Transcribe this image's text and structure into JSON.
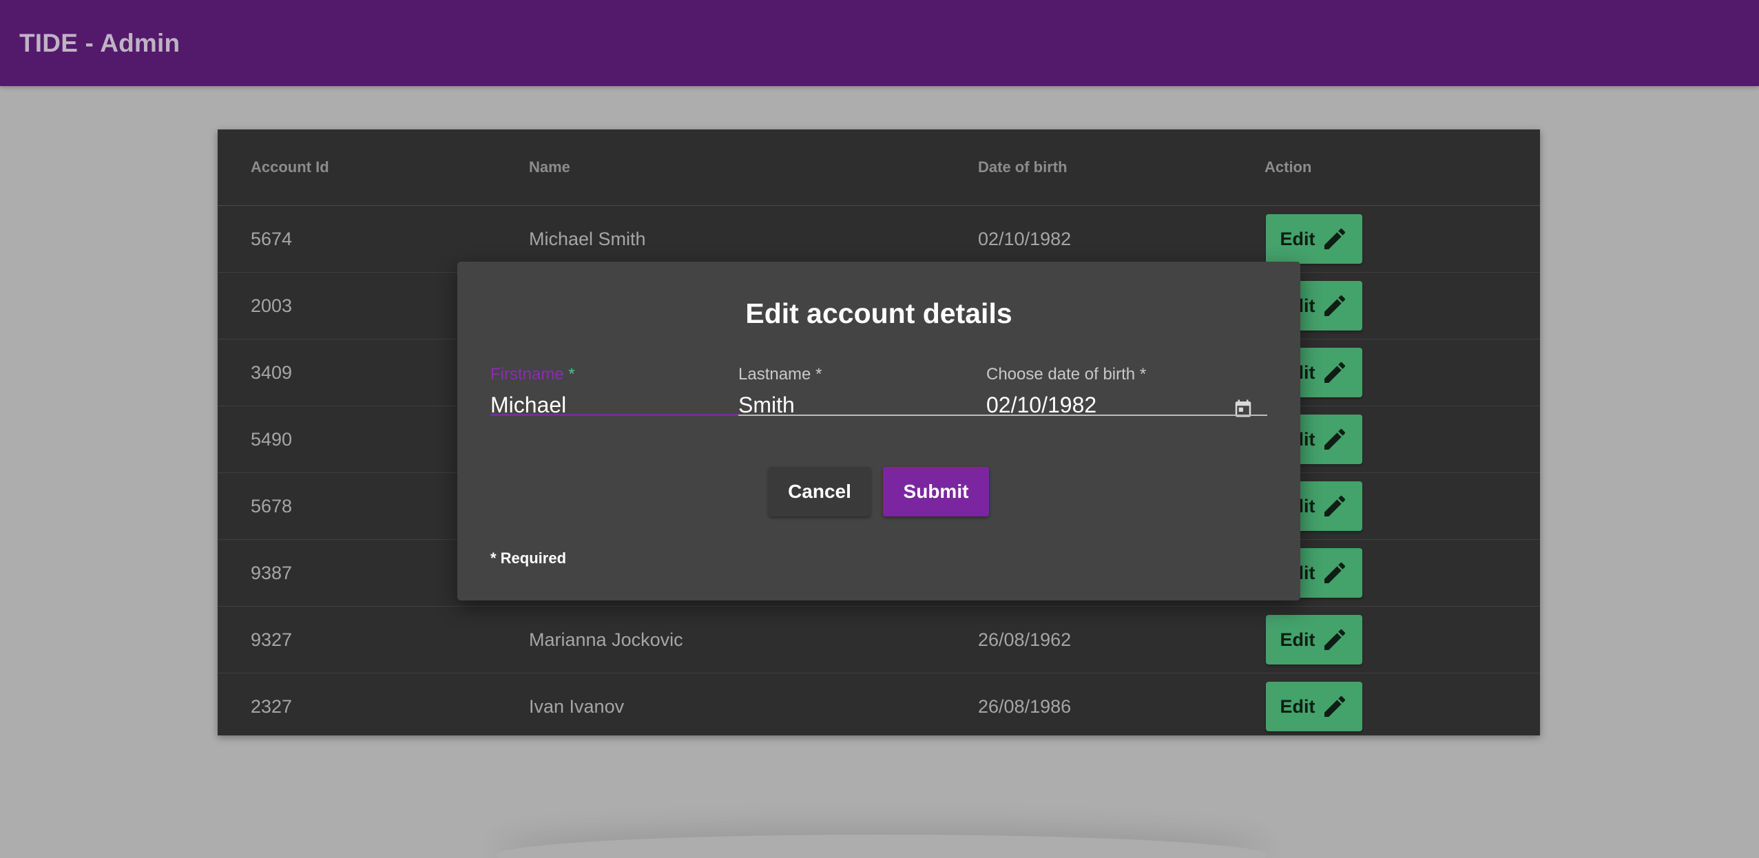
{
  "app": {
    "title": "TIDE - Admin"
  },
  "table": {
    "headers": {
      "id": "Account Id",
      "name": "Name",
      "dob": "Date of birth",
      "action": "Action"
    },
    "edit_label": "Edit",
    "rows": [
      {
        "id": "5674",
        "name": "Michael Smith",
        "dob": "02/10/1982"
      },
      {
        "id": "2003",
        "name": "",
        "dob": ""
      },
      {
        "id": "3409",
        "name": "",
        "dob": ""
      },
      {
        "id": "5490",
        "name": "",
        "dob": ""
      },
      {
        "id": "5678",
        "name": "",
        "dob": ""
      },
      {
        "id": "9387",
        "name": "",
        "dob": ""
      },
      {
        "id": "9327",
        "name": "Marianna Jockovic",
        "dob": "26/08/1962"
      },
      {
        "id": "2327",
        "name": "Ivan Ivanov",
        "dob": "26/08/1986"
      }
    ]
  },
  "dialog": {
    "title": "Edit account details",
    "firstname": {
      "label": "Firstname",
      "value": "Michael"
    },
    "lastname": {
      "label": "Lastname",
      "value": "Smith"
    },
    "dob": {
      "label": "Choose date of birth",
      "value": "02/10/1982"
    },
    "required_marker": "*",
    "cancel_label": "Cancel",
    "submit_label": "Submit",
    "required_note": "* Required"
  },
  "colors": {
    "topbar": "#53196b",
    "edit_button": "#44a26b",
    "submit_button": "#7b25a0",
    "focus_accent": "#7b2aa1"
  },
  "icons": {
    "edit": "pencil-icon",
    "calendar": "calendar-icon"
  }
}
